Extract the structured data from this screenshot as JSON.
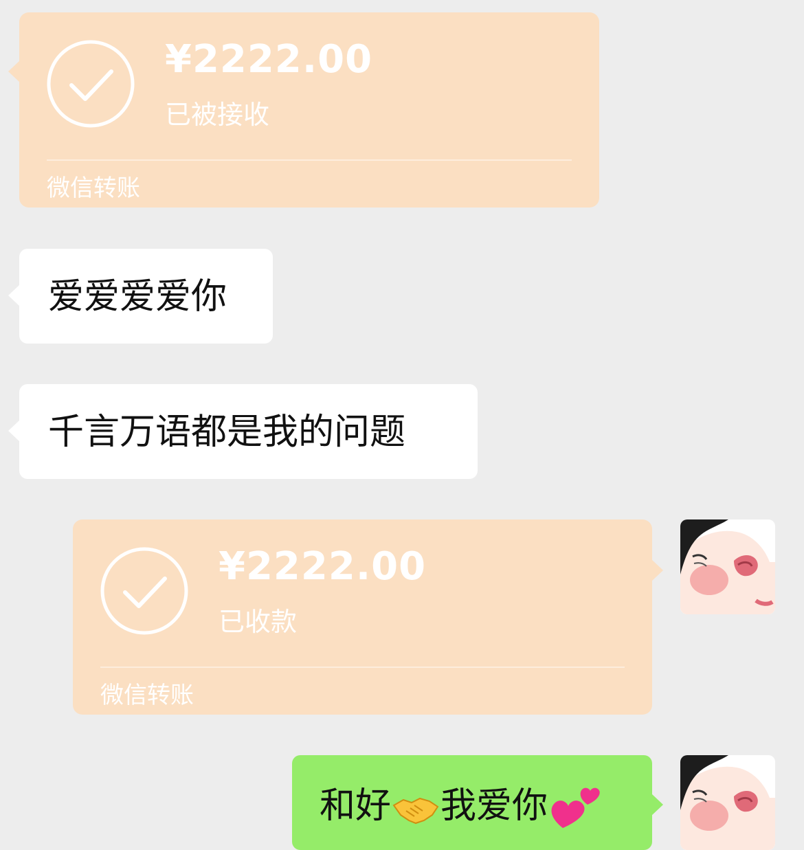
{
  "messages": {
    "transfer_1": {
      "amount": "¥2222.00",
      "status": "已被接收",
      "footer": "微信转账"
    },
    "text_1": "爱爱爱爱你",
    "text_2": "千言万语都是我的问题",
    "transfer_2": {
      "amount": "¥2222.00",
      "status": "已收款",
      "footer": "微信转账"
    },
    "text_3": {
      "before": "和好",
      "middle": "我爱你",
      "emoji_1": "handshake-emoji",
      "emoji_2": "two-hearts-emoji"
    }
  },
  "colors": {
    "background": "#ededed",
    "transfer_card": "#fbdfc2",
    "bubble_received": "#ffffff",
    "bubble_sent": "#95ec69"
  }
}
